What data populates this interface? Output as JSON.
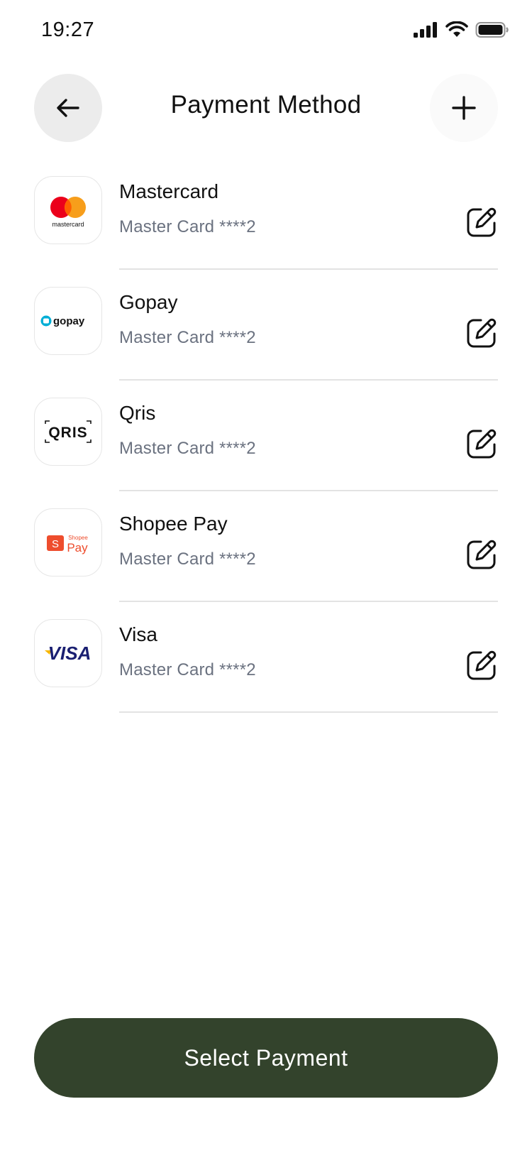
{
  "status_bar": {
    "time": "19:27"
  },
  "header": {
    "title": "Payment Method",
    "back_icon": "arrow-left-icon",
    "add_icon": "plus-icon"
  },
  "methods": [
    {
      "name": "Mastercard",
      "detail": "Master Card ****2",
      "logo_text": "mastercard",
      "edit_icon": "edit-icon"
    },
    {
      "name": "Gopay",
      "detail": "Master Card ****2",
      "logo_text": "gopay",
      "edit_icon": "edit-icon"
    },
    {
      "name": "Qris",
      "detail": "Master Card ****2",
      "logo_text": "QRIS",
      "edit_icon": "edit-icon"
    },
    {
      "name": "Shopee Pay",
      "detail": "Master Card ****2",
      "logo_text": "Shopee",
      "logo_text2": "Pay",
      "logo_badge": "S",
      "edit_icon": "edit-icon"
    },
    {
      "name": "Visa",
      "detail": "Master Card ****2",
      "logo_text": "VISA",
      "edit_icon": "edit-icon"
    }
  ],
  "footer": {
    "button_label": "Select Payment"
  },
  "colors": {
    "primary_button": "#33432c",
    "secondary_text": "#6b7280",
    "mastercard_red": "#eb001b",
    "mastercard_orange": "#f79e1b",
    "gopay_blue": "#00aed6",
    "shopee_orange": "#ee4d2d",
    "visa_blue": "#1a1f71",
    "visa_gold": "#f7b600"
  }
}
